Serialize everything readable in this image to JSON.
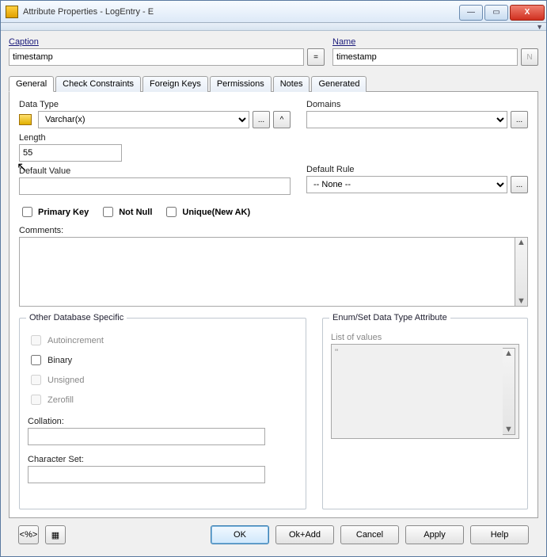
{
  "window": {
    "title": "Attribute Properties - LogEntry - E"
  },
  "winbtns": {
    "min": "—",
    "max": "▭",
    "close": "X"
  },
  "header": {
    "caption_label": "Caption",
    "name_label": "Name",
    "caption_value": "timestamp",
    "name_value": "timestamp",
    "eq_btn": "=",
    "n_btn": "N"
  },
  "tabs": [
    "General",
    "Check Constraints",
    "Foreign Keys",
    "Permissions",
    "Notes",
    "Generated"
  ],
  "general": {
    "datatype_label": "Data Type",
    "datatype_value": "Varchar(x)",
    "domains_label": "Domains",
    "domains_value": "",
    "length_label": "Length",
    "length_value": "55",
    "default_value_label": "Default Value",
    "default_value": "",
    "default_rule_label": "Default Rule",
    "default_rule_value": "-- None --",
    "ellipsis": "...",
    "caret": "^",
    "chk_primary": "Primary Key",
    "chk_notnull": "Not Null",
    "chk_unique": "Unique(New AK)",
    "comments_label": "Comments:",
    "comments_value": ""
  },
  "other": {
    "legend": "Other Database Specific",
    "autoincrement": "Autoincrement",
    "binary": "Binary",
    "unsigned": "Unsigned",
    "zerofill": "Zerofill",
    "collation_label": "Collation:",
    "collation_value": "",
    "charset_label": "Character Set:",
    "charset_value": ""
  },
  "enum": {
    "legend": "Enum/Set Data Type Attribute",
    "list_label": "List of values",
    "list_value": "''"
  },
  "footer": {
    "ok": "OK",
    "okadd": "Ok+Add",
    "cancel": "Cancel",
    "apply": "Apply",
    "help": "Help"
  }
}
